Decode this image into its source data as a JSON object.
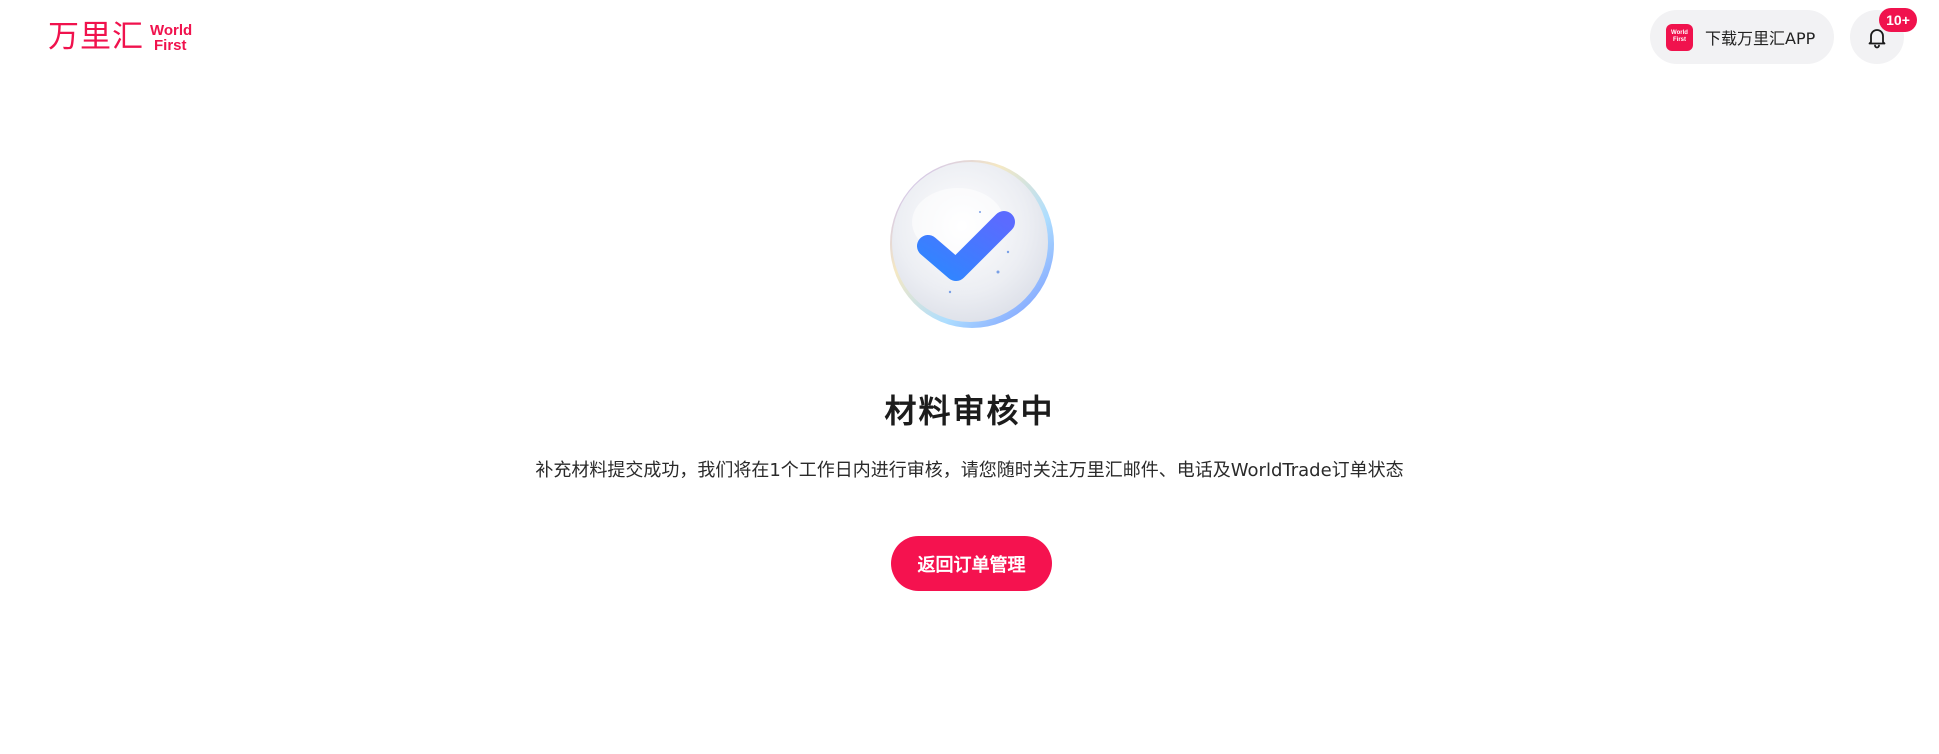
{
  "header": {
    "logo_cn": "万里汇",
    "logo_en_line1": "World",
    "logo_en_line2": "First",
    "download_app_label": "下载万里汇APP",
    "app_icon_text_line1": "World",
    "app_icon_text_line2": "First",
    "notification_badge": "10+"
  },
  "status": {
    "icon": "checkmark-circle-icon",
    "title": "材料审核中",
    "description": "补充材料提交成功，我们将在1个工作日内进行审核，请您随时关注万里汇邮件、电话及WorldTrade订单状态",
    "back_button_label": "返回订单管理"
  },
  "colors": {
    "brand": "#f0124d",
    "button_bg": "#f5124f",
    "pill_bg": "#f2f2f4",
    "check_gradient_start": "#2f86ff",
    "check_gradient_end": "#5b6bff"
  }
}
